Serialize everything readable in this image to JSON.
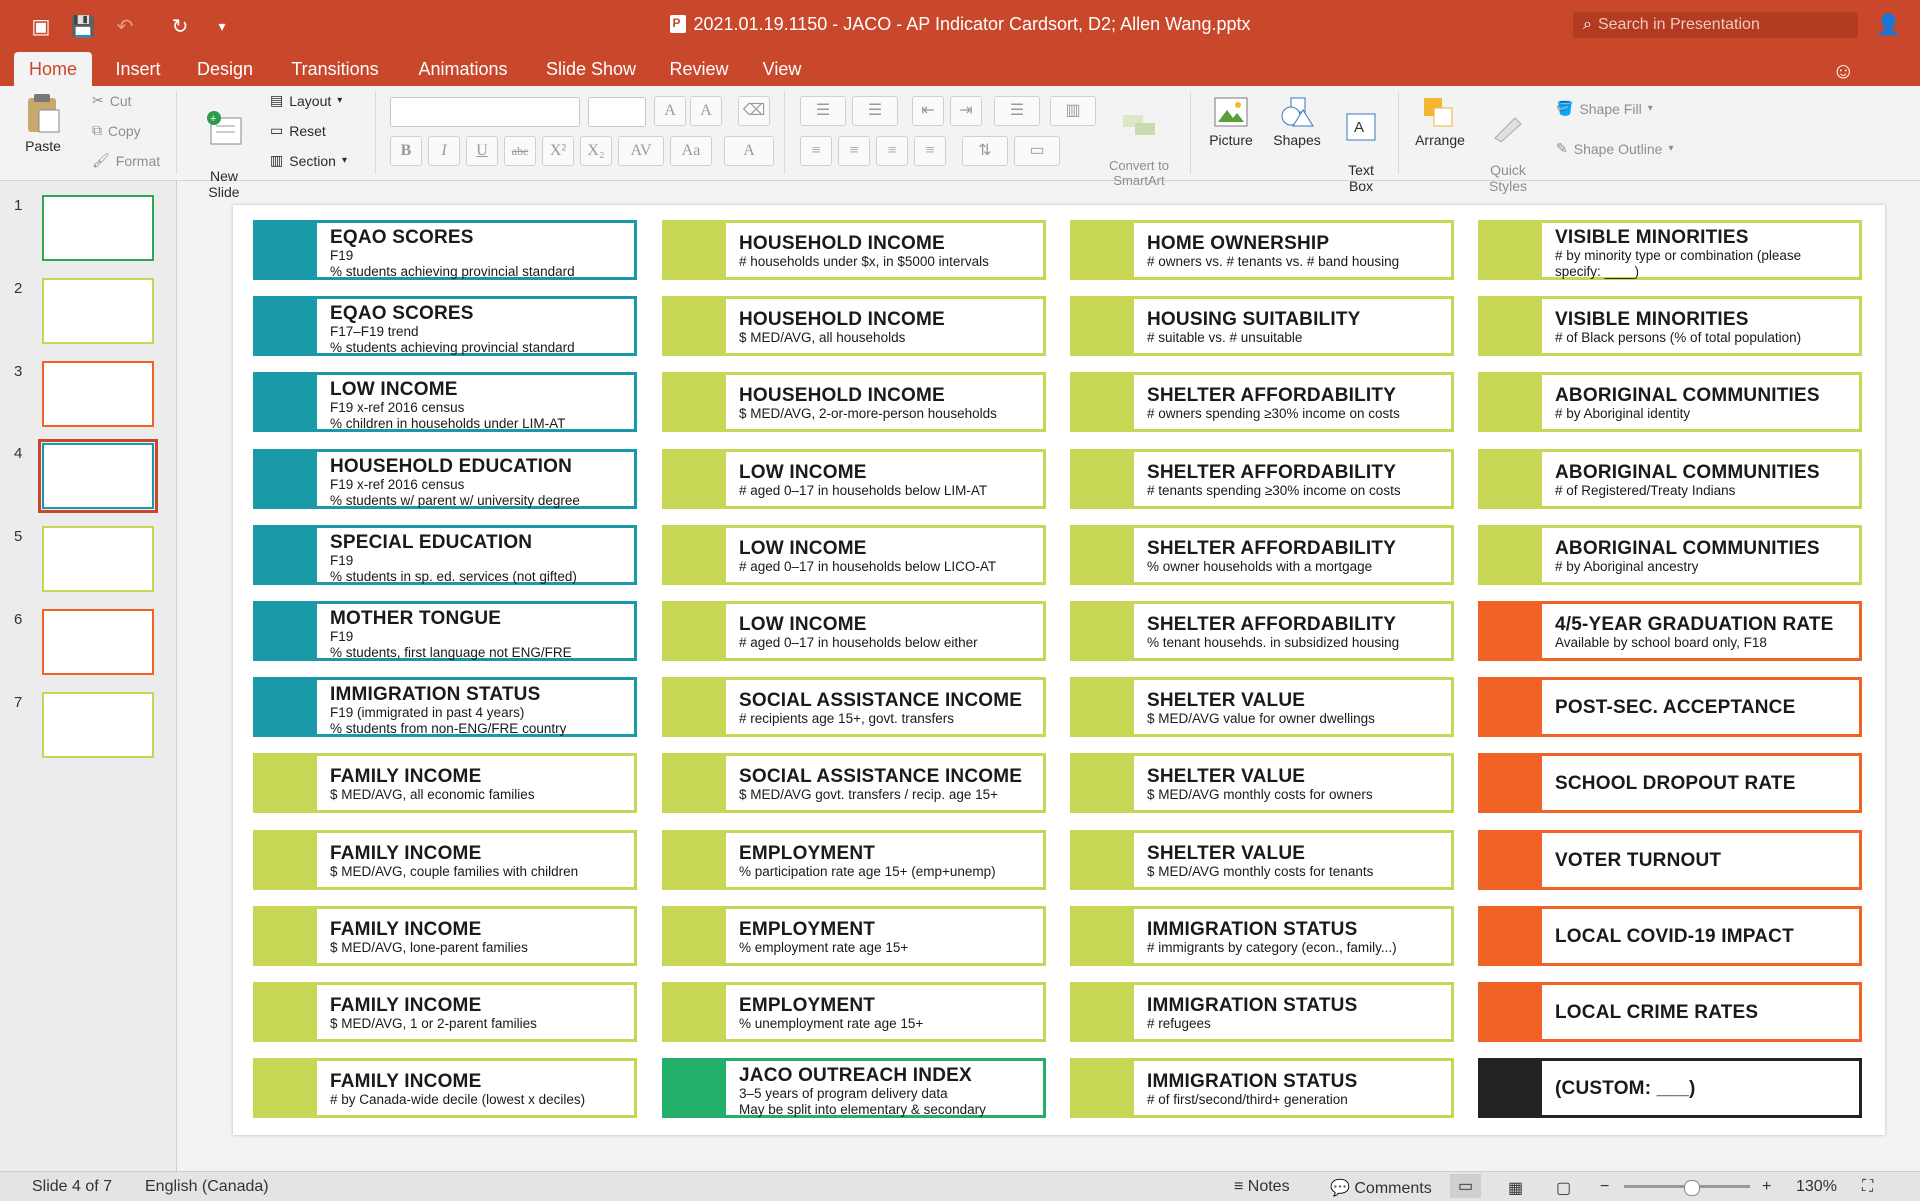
{
  "window": {
    "title": "2021.01.19.1150 - JACO - AP Indicator Cardsort, D2; Allen Wang.pptx",
    "search_placeholder": "Search in Presentation"
  },
  "tabs": [
    {
      "label": "Home",
      "active": true
    },
    {
      "label": "Insert"
    },
    {
      "label": "Design"
    },
    {
      "label": "Transitions"
    },
    {
      "label": "Animations"
    },
    {
      "label": "Slide Show"
    },
    {
      "label": "Review"
    },
    {
      "label": "View"
    }
  ],
  "ribbon": {
    "paste": "Paste",
    "cut": "Cut",
    "copy": "Copy",
    "format": "Format",
    "new_slide": "New\nSlide",
    "layout": "Layout",
    "reset": "Reset",
    "section": "Section",
    "convert_smartart": "Convert to\nSmartArt",
    "picture": "Picture",
    "shapes": "Shapes",
    "text_box": "Text\nBox",
    "arrange": "Arrange",
    "quick_styles": "Quick\nStyles",
    "shape_fill": "Shape Fill",
    "shape_outline": "Shape Outline"
  },
  "thumbnails": [
    "1",
    "2",
    "3",
    "4",
    "5",
    "6",
    "7"
  ],
  "selected_slide": 4,
  "colors": {
    "accent": "#c9472a",
    "lime": "#c8d655",
    "teal": "#1a9aa8",
    "orange": "#f06225",
    "green": "#22b06a",
    "black": "#222222"
  },
  "cards": {
    "col1": [
      {
        "color": "teal",
        "title": "EQAO SCORES",
        "lines": [
          "F19",
          "% students achieving provincial standard"
        ]
      },
      {
        "color": "teal",
        "title": "EQAO SCORES",
        "lines": [
          "F17–F19 trend",
          "% students achieving provincial standard"
        ]
      },
      {
        "color": "teal",
        "title": "LOW INCOME",
        "lines": [
          "F19 x-ref 2016 census",
          "% children in households under LIM-AT"
        ]
      },
      {
        "color": "teal",
        "title": "HOUSEHOLD EDUCATION",
        "lines": [
          "F19 x-ref 2016 census",
          "% students w/ parent w/ university degree"
        ]
      },
      {
        "color": "teal",
        "title": "SPECIAL EDUCATION",
        "lines": [
          "F19",
          "% students in sp. ed. services (not gifted)"
        ]
      },
      {
        "color": "teal",
        "title": "MOTHER TONGUE",
        "lines": [
          "F19",
          "% students, first language not ENG/FRE"
        ]
      },
      {
        "color": "teal",
        "title": "IMMIGRATION STATUS",
        "lines": [
          "F19 (immigrated in past 4 years)",
          "% students from non-ENG/FRE country"
        ]
      },
      {
        "color": "lime",
        "title": "FAMILY INCOME",
        "lines": [
          "$ MED/AVG, all economic families"
        ]
      },
      {
        "color": "lime",
        "title": "FAMILY INCOME",
        "lines": [
          "$ MED/AVG, couple families with children"
        ]
      },
      {
        "color": "lime",
        "title": "FAMILY INCOME",
        "lines": [
          "$ MED/AVG, lone-parent families"
        ]
      },
      {
        "color": "lime",
        "title": "FAMILY INCOME",
        "lines": [
          "$ MED/AVG, 1 or 2-parent families"
        ]
      },
      {
        "color": "lime",
        "title": "FAMILY INCOME",
        "lines": [
          "# by Canada-wide decile (lowest x deciles)"
        ]
      }
    ],
    "col2": [
      {
        "color": "lime",
        "title": "HOUSEHOLD INCOME",
        "lines": [
          "# households under $x, in $5000 intervals"
        ]
      },
      {
        "color": "lime",
        "title": "HOUSEHOLD INCOME",
        "lines": [
          "$ MED/AVG, all households"
        ]
      },
      {
        "color": "lime",
        "title": "HOUSEHOLD INCOME",
        "lines": [
          "$ MED/AVG, 2-or-more-person households"
        ]
      },
      {
        "color": "lime",
        "title": "LOW INCOME",
        "lines": [
          "# aged 0–17 in households below LIM-AT"
        ]
      },
      {
        "color": "lime",
        "title": "LOW INCOME",
        "lines": [
          "# aged 0–17 in households below LICO-AT"
        ]
      },
      {
        "color": "lime",
        "title": "LOW INCOME",
        "lines": [
          "# aged 0–17 in households below either"
        ]
      },
      {
        "color": "lime",
        "title": "SOCIAL ASSISTANCE INCOME",
        "lines": [
          "# recipients age 15+, govt. transfers"
        ]
      },
      {
        "color": "lime",
        "title": "SOCIAL ASSISTANCE INCOME",
        "lines": [
          "$ MED/AVG govt. transfers / recip. age 15+"
        ]
      },
      {
        "color": "lime",
        "title": "EMPLOYMENT",
        "lines": [
          "% participation rate age 15+ (emp+unemp)"
        ]
      },
      {
        "color": "lime",
        "title": "EMPLOYMENT",
        "lines": [
          "% employment rate age 15+"
        ]
      },
      {
        "color": "lime",
        "title": "EMPLOYMENT",
        "lines": [
          "% unemployment rate age 15+"
        ]
      },
      {
        "color": "green",
        "title": "JACO OUTREACH INDEX",
        "lines": [
          "3–5 years of program delivery data",
          "May be split into elementary & secondary"
        ]
      }
    ],
    "col3": [
      {
        "color": "lime",
        "title": "HOME OWNERSHIP",
        "lines": [
          "# owners vs. # tenants vs. # band housing"
        ]
      },
      {
        "color": "lime",
        "title": "HOUSING SUITABILITY",
        "lines": [
          "# suitable vs. # unsuitable"
        ]
      },
      {
        "color": "lime",
        "title": "SHELTER AFFORDABILITY",
        "lines": [
          "# owners spending ≥30% income on costs"
        ]
      },
      {
        "color": "lime",
        "title": "SHELTER AFFORDABILITY",
        "lines": [
          "# tenants spending ≥30% income on costs"
        ]
      },
      {
        "color": "lime",
        "title": "SHELTER AFFORDABILITY",
        "lines": [
          "% owner households with a mortgage"
        ]
      },
      {
        "color": "lime",
        "title": "SHELTER AFFORDABILITY",
        "lines": [
          "% tenant househds. in subsidized housing"
        ]
      },
      {
        "color": "lime",
        "title": "SHELTER VALUE",
        "lines": [
          "$ MED/AVG value for owner dwellings"
        ]
      },
      {
        "color": "lime",
        "title": "SHELTER VALUE",
        "lines": [
          "$ MED/AVG monthly costs for owners"
        ]
      },
      {
        "color": "lime",
        "title": "SHELTER VALUE",
        "lines": [
          "$ MED/AVG monthly costs for tenants"
        ]
      },
      {
        "color": "lime",
        "title": "IMMIGRATION STATUS",
        "lines": [
          "# immigrants by category (econ., family...)"
        ]
      },
      {
        "color": "lime",
        "title": "IMMIGRATION STATUS",
        "lines": [
          "# refugees"
        ]
      },
      {
        "color": "lime",
        "title": "IMMIGRATION STATUS",
        "lines": [
          "# of first/second/third+ generation"
        ]
      }
    ],
    "col4": [
      {
        "color": "lime",
        "title": "VISIBLE MINORITIES",
        "lines": [
          "# by minority type or combination (please",
          "specify: ____)"
        ]
      },
      {
        "color": "lime",
        "title": "VISIBLE MINORITIES",
        "lines": [
          "# of Black persons (% of total population)"
        ]
      },
      {
        "color": "lime",
        "title": "ABORIGINAL COMMUNITIES",
        "lines": [
          "# by Aboriginal identity"
        ]
      },
      {
        "color": "lime",
        "title": "ABORIGINAL COMMUNITIES",
        "lines": [
          "# of Registered/Treaty Indians"
        ]
      },
      {
        "color": "lime",
        "title": "ABORIGINAL COMMUNITIES",
        "lines": [
          "# by Aboriginal ancestry"
        ]
      },
      {
        "color": "orange",
        "title": "4/5-YEAR GRADUATION RATE",
        "lines": [
          "Available by school board only, F18"
        ]
      },
      {
        "color": "orange",
        "title": "POST-SEC. ACCEPTANCE",
        "lines": []
      },
      {
        "color": "orange",
        "title": "SCHOOL DROPOUT RATE",
        "lines": []
      },
      {
        "color": "orange",
        "title": "VOTER TURNOUT",
        "lines": []
      },
      {
        "color": "orange",
        "title": "LOCAL COVID-19 IMPACT",
        "lines": []
      },
      {
        "color": "orange",
        "title": "LOCAL CRIME RATES",
        "lines": []
      },
      {
        "color": "black",
        "title": "(CUSTOM: ___)",
        "lines": []
      }
    ]
  },
  "status": {
    "slide_of": "Slide 4 of 7",
    "language": "English (Canada)",
    "notes": "Notes",
    "comments": "Comments",
    "zoom": "130%"
  }
}
